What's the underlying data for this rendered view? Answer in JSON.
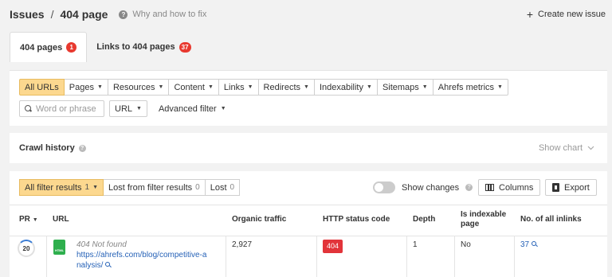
{
  "header": {
    "breadcrumb_root": "Issues",
    "separator": "/",
    "page_title": "404 page",
    "help_link": "Why and how to fix",
    "create_issue": "Create new issue"
  },
  "tabs": [
    {
      "label": "404 pages",
      "badge": "1",
      "active": true
    },
    {
      "label": "Links to 404 pages",
      "badge": "37",
      "active": false
    }
  ],
  "filters": {
    "buttons": [
      {
        "label": "All URLs",
        "selected": true
      },
      {
        "label": "Pages"
      },
      {
        "label": "Resources"
      },
      {
        "label": "Content"
      },
      {
        "label": "Links"
      },
      {
        "label": "Redirects"
      },
      {
        "label": "Indexability"
      },
      {
        "label": "Sitemaps"
      },
      {
        "label": "Ahrefs metrics"
      }
    ],
    "search_placeholder": "Word or phrase",
    "url_select": "URL",
    "advanced_filter": "Advanced filter"
  },
  "crawl_history": {
    "title": "Crawl history",
    "show_chart": "Show chart"
  },
  "results_toolbar": {
    "all_results_label": "All filter results",
    "all_results_count": "1",
    "lost_from_label": "Lost from filter results",
    "lost_from_count": "0",
    "lost_label": "Lost",
    "lost_count": "0",
    "show_changes": "Show changes",
    "columns": "Columns",
    "export": "Export"
  },
  "table": {
    "headers": {
      "pr": "PR",
      "url": "URL",
      "organic_traffic": "Organic traffic",
      "http_status": "HTTP status code",
      "depth": "Depth",
      "is_indexable_1": "Is indexable",
      "is_indexable_2": "page",
      "inlinks": "No. of all inlinks"
    },
    "rows": [
      {
        "pr": "20",
        "title": "404 Not found",
        "url_line1": "https://ahrefs.com/blog/competitive-a",
        "url_line2": "nalysis/",
        "organic_traffic": "2,927",
        "http_status": "404",
        "depth": "1",
        "is_indexable": "No",
        "inlinks": "37"
      }
    ]
  },
  "colors": {
    "accent_selected": "#fcd88f",
    "badge_red": "#e8392f",
    "link_blue": "#2662b7",
    "status_red": "#e2343a",
    "html_icon_green": "#2eaf4d"
  }
}
